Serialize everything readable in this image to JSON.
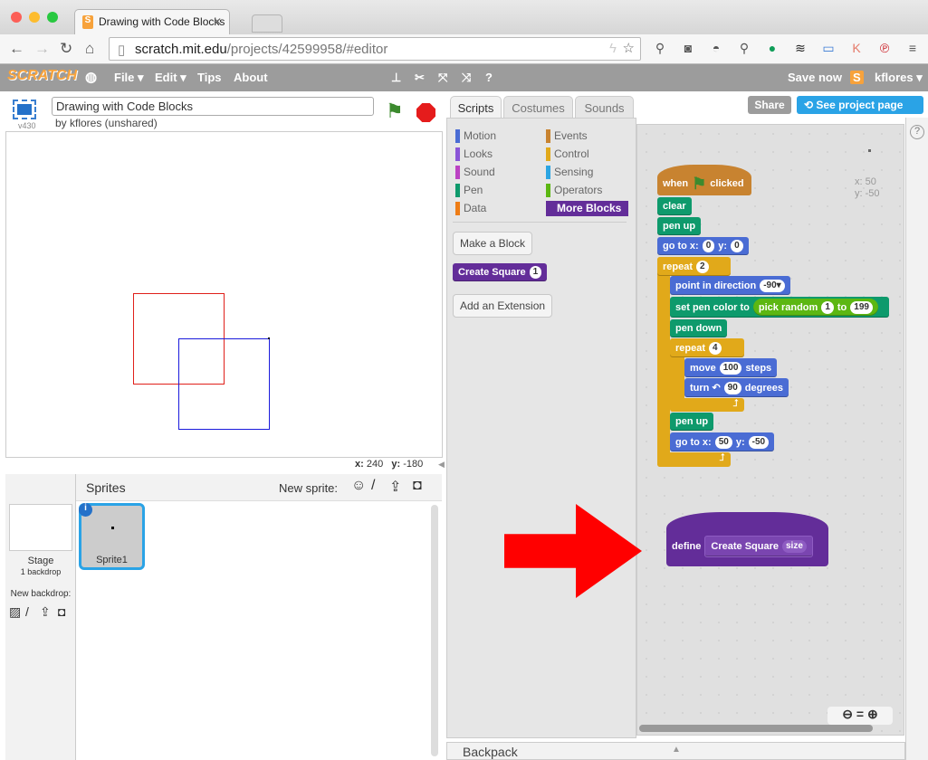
{
  "browser": {
    "tab_title": "Drawing with Code Blocks",
    "tab_favicon": "S",
    "url_host": "scratch.mit.edu",
    "url_path": "/projects/42599958/#editor"
  },
  "menubar": {
    "logo": "SCRATCH",
    "items": [
      "File ▾",
      "Edit ▾",
      "Tips",
      "About"
    ],
    "save_now": "Save now",
    "user": "kflores ▾"
  },
  "stage": {
    "version": "v430",
    "project_title": "Drawing with Code Blocks",
    "byline": "by kflores (unshared)",
    "x_label": "x:",
    "x_value": "240",
    "y_label": "y:",
    "y_value": "-180",
    "pen_colors": {
      "square1": "#e0201a",
      "square2": "#1a1adc"
    }
  },
  "sprites": {
    "header": "Sprites",
    "new_sprite": "New sprite:",
    "stage_label": "Stage",
    "stage_sub": "1 backdrop",
    "new_backdrop": "New backdrop:",
    "sprite_name": "Sprite1"
  },
  "tabs": [
    "Scripts",
    "Costumes",
    "Sounds"
  ],
  "share": "Share",
  "see_project": "See project page",
  "categories": [
    {
      "label": "Motion",
      "color": "#4a6cd4"
    },
    {
      "label": "Events",
      "color": "#c88330"
    },
    {
      "label": "Looks",
      "color": "#8a55d7"
    },
    {
      "label": "Control",
      "color": "#e1a91a"
    },
    {
      "label": "Sound",
      "color": "#bb42c3"
    },
    {
      "label": "Sensing",
      "color": "#2ca5e2"
    },
    {
      "label": "Pen",
      "color": "#0e9a6c"
    },
    {
      "label": "Operators",
      "color": "#5cb712"
    },
    {
      "label": "Data",
      "color": "#ee7d16"
    },
    {
      "label": "More Blocks",
      "color": "#632d99"
    }
  ],
  "palette": {
    "make_block": "Make a Block",
    "custom_block": "Create Square",
    "custom_arg": "1",
    "add_extension": "Add an Extension"
  },
  "script": {
    "sprite_x": "x: 50",
    "sprite_y": "y: -50",
    "when": "when",
    "clicked": "clicked",
    "clear": "clear",
    "pen_up": "pen up",
    "go_to_x": "go to x:",
    "y": "y:",
    "x0": "0",
    "y0": "0",
    "repeat": "repeat",
    "repeat_outer": "2",
    "point_dir": "point in direction",
    "dir": "-90▾",
    "set_pen_color": "set pen color to",
    "pick_random": "pick random",
    "rand_from": "1",
    "to": "to",
    "rand_to": "199",
    "pen_down": "pen down",
    "repeat_inner": "4",
    "move": "move",
    "steps_val": "100",
    "steps": "steps",
    "turn": "turn ↶",
    "turn_val": "90",
    "degrees": "degrees",
    "pen_up2": "pen up",
    "x50": "50",
    "y_50": "-50"
  },
  "define_block": {
    "define": "define",
    "name": "Create Square",
    "param": "size"
  },
  "backpack": "Backpack"
}
